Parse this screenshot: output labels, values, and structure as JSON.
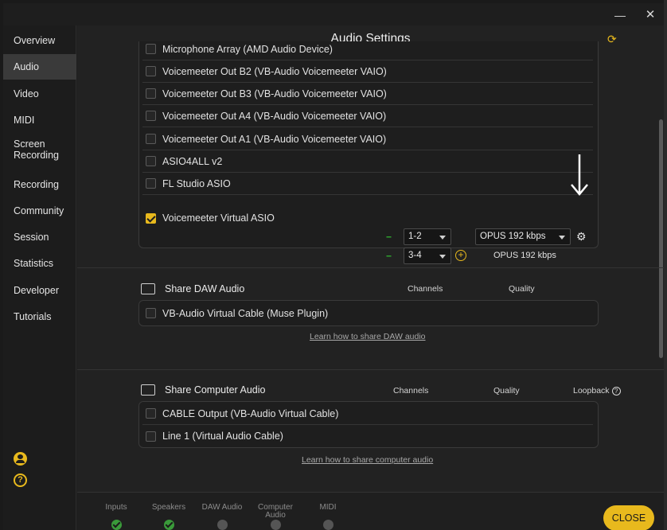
{
  "window": {
    "minimize": "—",
    "close": "✕"
  },
  "sidebar": {
    "items": [
      {
        "label": "Overview",
        "active": false
      },
      {
        "label": "Audio",
        "active": true
      },
      {
        "label": "Video",
        "active": false
      },
      {
        "label": "MIDI",
        "active": false
      },
      {
        "label": "Screen Recording",
        "active": false
      },
      {
        "label": "Recording",
        "active": false
      },
      {
        "label": "Community",
        "active": false
      },
      {
        "label": "Session",
        "active": false
      },
      {
        "label": "Statistics",
        "active": false
      },
      {
        "label": "Developer",
        "active": false
      },
      {
        "label": "Tutorials",
        "active": false
      }
    ],
    "help_glyph": "?"
  },
  "header": {
    "title": "Audio Settings",
    "refresh_icon": "refresh-icon"
  },
  "devices": {
    "rows": [
      {
        "label": "Microphone Array (AMD Audio Device)",
        "checked": false
      },
      {
        "label": "Voicemeeter Out B2 (VB-Audio Voicemeeter VAIO)",
        "checked": false
      },
      {
        "label": "Voicemeeter Out B3 (VB-Audio Voicemeeter VAIO)",
        "checked": false
      },
      {
        "label": "Voicemeeter Out A4 (VB-Audio Voicemeeter VAIO)",
        "checked": false
      },
      {
        "label": "Voicemeeter Out A1 (VB-Audio Voicemeeter VAIO)",
        "checked": false
      },
      {
        "label": "ASIO4ALL v2",
        "checked": false
      },
      {
        "label": "FL Studio ASIO",
        "checked": false
      },
      {
        "label": "Voicemeeter Virtual ASIO",
        "checked": true
      }
    ],
    "active_device": {
      "channel_1": "1-2",
      "channel_2": "3-4",
      "level_1": "--",
      "level_2": "--",
      "quality_select": "OPUS 192 kbps",
      "quality_static": "OPUS 192 kbps",
      "add_glyph": "+",
      "gear_glyph": "⚙"
    }
  },
  "share_daw": {
    "title": "Share DAW Audio",
    "col_channels": "Channels",
    "col_quality": "Quality",
    "rows": [
      {
        "label": "VB-Audio Virtual Cable (Muse Plugin)",
        "checked": false
      }
    ],
    "link": "Learn how to share DAW audio"
  },
  "share_computer": {
    "title": "Share Computer Audio",
    "col_channels": "Channels",
    "col_quality": "Quality",
    "col_loopback": "Loopback",
    "loopback_help": "?",
    "rows": [
      {
        "label": "CABLE Output (VB-Audio Virtual Cable)",
        "checked": false
      },
      {
        "label": "Line 1 (Virtual Audio Cable)",
        "checked": false
      }
    ],
    "link": "Learn how to share computer audio"
  },
  "status": {
    "items": [
      {
        "label": "Inputs",
        "ok": true
      },
      {
        "label": "Speakers",
        "ok": true
      },
      {
        "label": "DAW Audio",
        "ok": false
      },
      {
        "label": "Computer Audio",
        "ok": false
      },
      {
        "label": "MIDI",
        "ok": false
      }
    ],
    "close_label": "CLOSE"
  },
  "colors": {
    "accent": "#e8b91d",
    "ok": "#3a9a3a",
    "bg": "#222222"
  }
}
